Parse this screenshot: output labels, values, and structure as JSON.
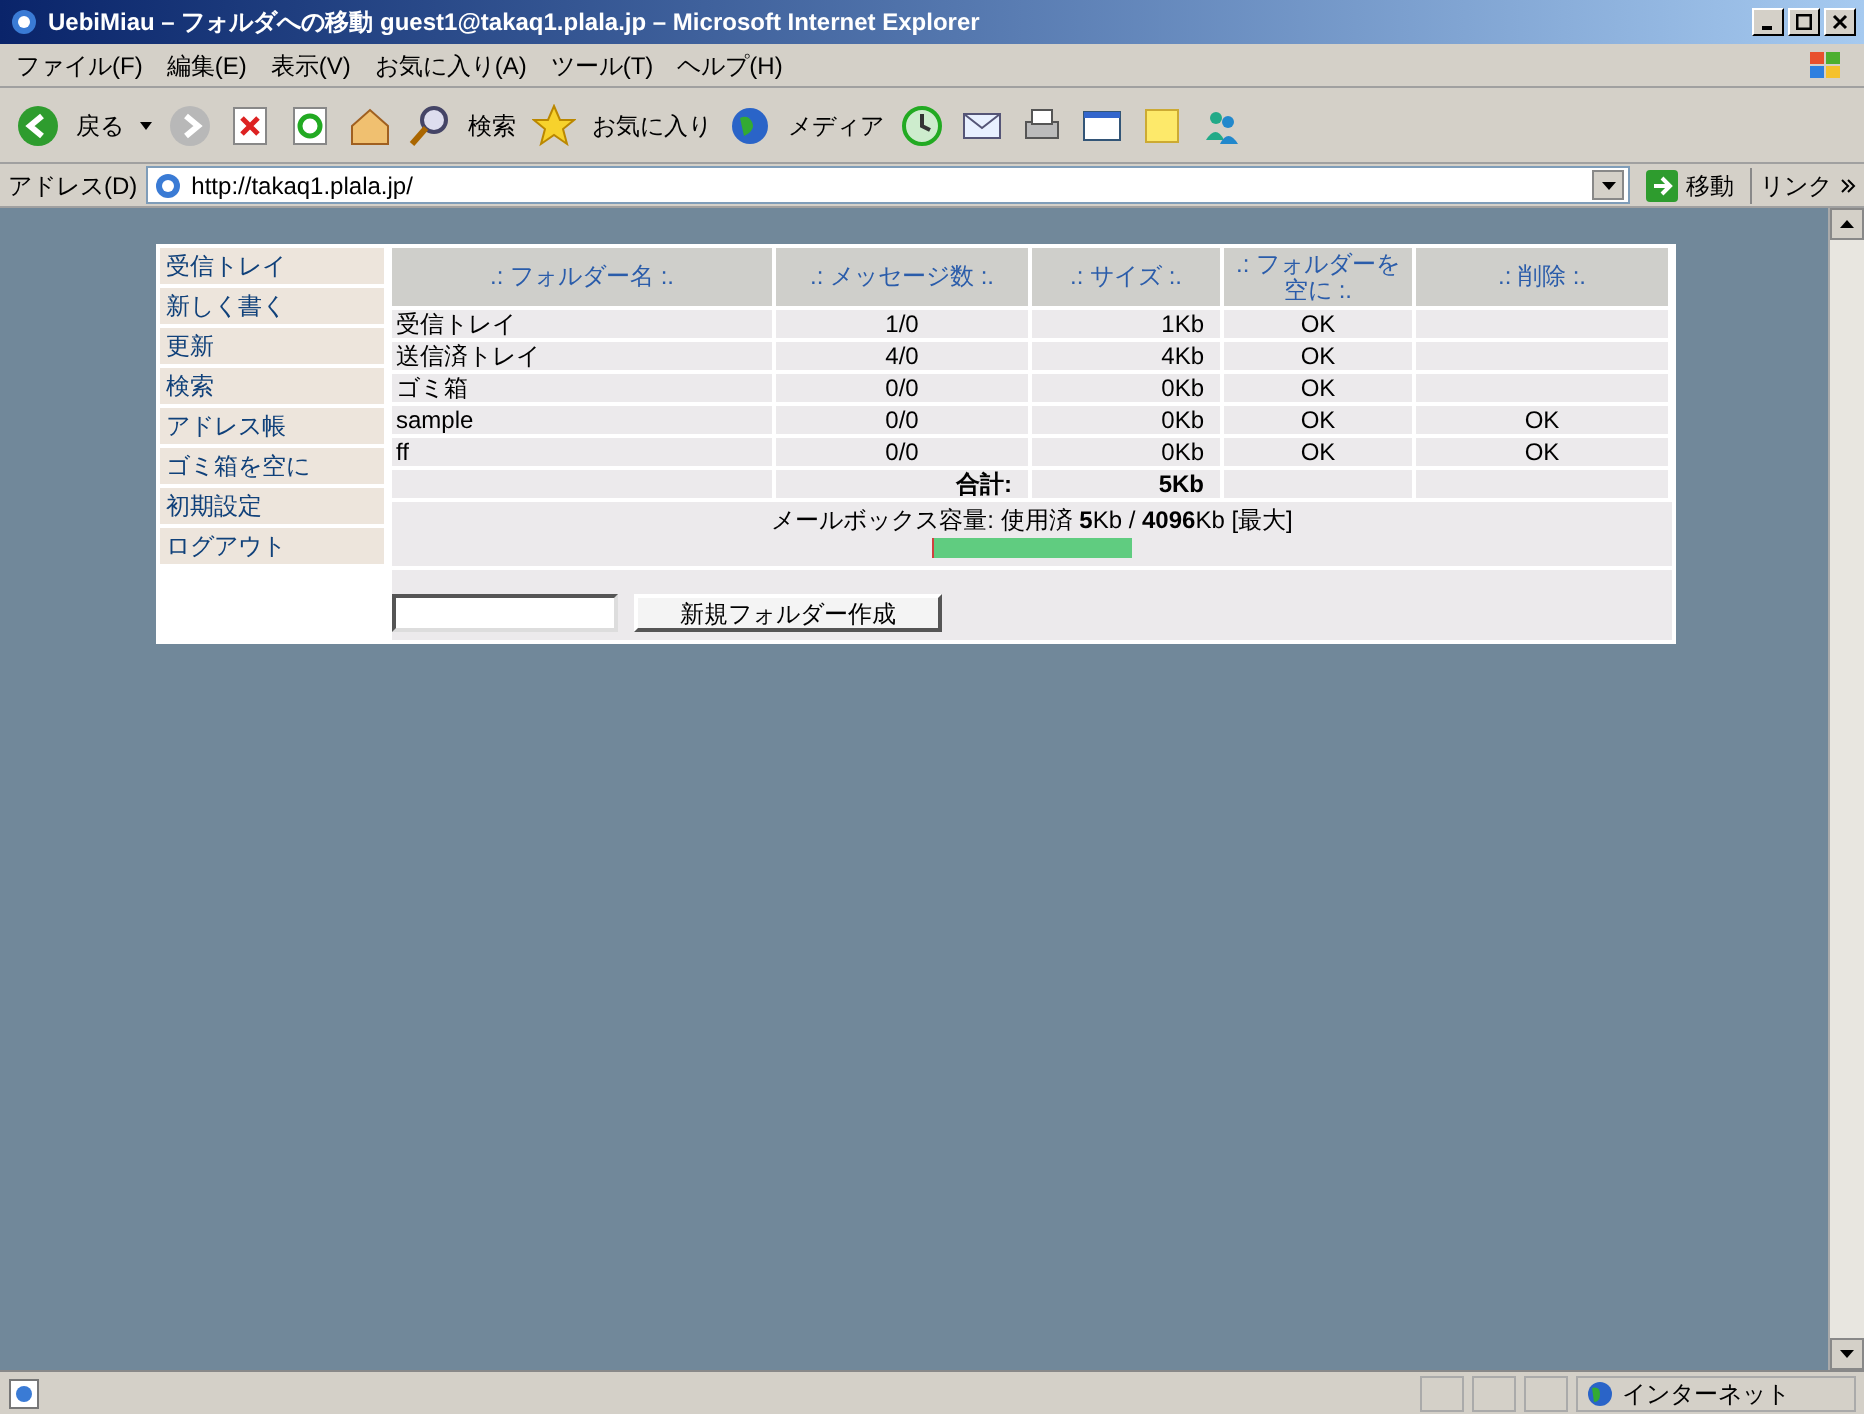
{
  "window": {
    "title": "UebiMiau – フォルダへの移動 guest1@takaq1.plala.jp – Microsoft Internet Explorer"
  },
  "menu": [
    "ファイル(F)",
    "編集(E)",
    "表示(V)",
    "お気に入り(A)",
    "ツール(T)",
    "ヘルプ(H)"
  ],
  "toolbar": {
    "back": "戻る",
    "search": "検索",
    "favorites": "お気に入り",
    "media": "メディア"
  },
  "address": {
    "label": "アドレス(D)",
    "value": "http://takaq1.plala.jp/",
    "go": "移動",
    "links": "リンク"
  },
  "sidebar": {
    "items": [
      "受信トレイ",
      "新しく書く",
      "更新",
      "検索",
      "アドレス帳",
      "ゴミ箱を空に",
      "初期設定",
      "ログアウト"
    ]
  },
  "table": {
    "columns": [
      ".: フォルダー名 :.",
      ".: メッセージ数 :.",
      ".: サイズ :.",
      ".: フォルダーを空に :.",
      ".: 削除 :."
    ],
    "rows": [
      {
        "name": "受信トレイ",
        "messages": "1/0",
        "size": "1Kb",
        "empty": "OK"
      },
      {
        "name": "送信済トレイ",
        "messages": "4/0",
        "size": "4Kb",
        "empty": "OK"
      },
      {
        "name": "ゴミ箱",
        "messages": "0/0",
        "size": "0Kb",
        "empty": "OK"
      },
      {
        "name": "sample",
        "messages": "0/0",
        "size": "0Kb",
        "empty": "OK",
        "delete": "OK"
      },
      {
        "name": "ff",
        "messages": "0/0",
        "size": "0Kb",
        "empty": "OK",
        "delete": "OK"
      }
    ],
    "total_label": "合計:",
    "total": "5Kb"
  },
  "quota": {
    "text": "メールボックス容量: 使用済 **5**Kb / **4096**Kb [最大]",
    "level": 0.01
  },
  "new_folder": {
    "button": "新規フォルダー作成"
  },
  "status_bar": {
    "zone": "インターネット"
  }
}
